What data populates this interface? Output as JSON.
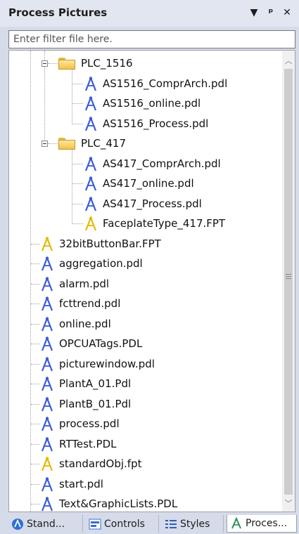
{
  "panel": {
    "title": "Process Pictures",
    "dropdown_icon": "dropdown-arrow-icon",
    "pin_icon": "pin-icon",
    "close_icon": "close-icon"
  },
  "filter": {
    "placeholder": "Enter filter file here.",
    "value": ""
  },
  "tree": {
    "folders": [
      {
        "label": "PLC_1516",
        "icon": "folder-icon",
        "expanded": true
      },
      {
        "label": "PLC_417",
        "icon": "folder-icon",
        "expanded": true
      }
    ],
    "plc1516_files": [
      {
        "label": "AS1516_ComprArch.pdl",
        "icon": "blue-picture-icon"
      },
      {
        "label": "AS1516_online.pdl",
        "icon": "blue-picture-icon"
      },
      {
        "label": "AS1516_Process.pdl",
        "icon": "blue-picture-icon"
      }
    ],
    "plc417_files": [
      {
        "label": "AS417_ComprArch.pdl",
        "icon": "blue-picture-icon"
      },
      {
        "label": "AS417_online.pdl",
        "icon": "blue-picture-icon"
      },
      {
        "label": "AS417_Process.pdl",
        "icon": "blue-picture-icon"
      },
      {
        "label": "FaceplateType_417.FPT",
        "icon": "yellow-faceplate-icon"
      }
    ],
    "root_files": [
      {
        "label": "32bitButtonBar.FPT",
        "icon": "yellow-faceplate-icon"
      },
      {
        "label": "aggregation.pdl",
        "icon": "blue-picture-icon"
      },
      {
        "label": "alarm.pdl",
        "icon": "blue-picture-icon"
      },
      {
        "label": "fcttrend.pdl",
        "icon": "blue-picture-icon"
      },
      {
        "label": "online.pdl",
        "icon": "blue-picture-icon"
      },
      {
        "label": "OPCUATags.PDL",
        "icon": "blue-picture-icon"
      },
      {
        "label": "picturewindow.pdl",
        "icon": "blue-picture-icon"
      },
      {
        "label": "PlantA_01.Pdl",
        "icon": "blue-picture-icon"
      },
      {
        "label": "PlantB_01.Pdl",
        "icon": "blue-picture-icon"
      },
      {
        "label": "process.pdl",
        "icon": "blue-picture-icon"
      },
      {
        "label": "RTTest.PDL",
        "icon": "blue-picture-icon"
      },
      {
        "label": "standardObj.fpt",
        "icon": "yellow-faceplate-icon"
      },
      {
        "label": "start.pdl",
        "icon": "blue-picture-icon"
      },
      {
        "label": "Text&GraphicLists.PDL",
        "icon": "blue-picture-icon"
      }
    ]
  },
  "tabs": [
    {
      "label": "Stand...",
      "icon": "standard-objects-icon",
      "active": false
    },
    {
      "label": "Controls",
      "icon": "controls-icon",
      "active": false
    },
    {
      "label": "Styles",
      "icon": "styles-icon",
      "active": false
    },
    {
      "label": "Proces...",
      "icon": "process-pictures-icon",
      "active": true
    }
  ],
  "colors": {
    "picture_icon": "#3a5bd9",
    "faceplate_icon": "#e8b800",
    "folder": "#f2c14b",
    "background": "#d6dbe9"
  }
}
